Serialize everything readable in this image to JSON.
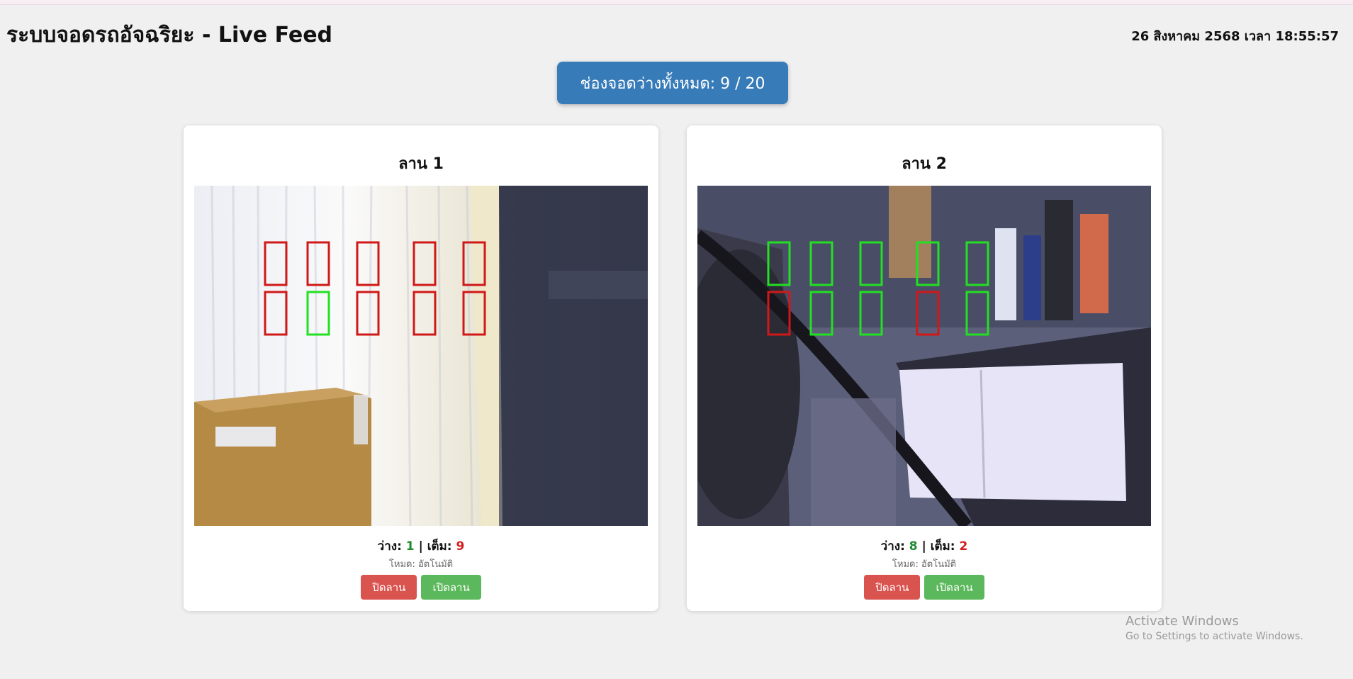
{
  "header": {
    "title": "ระบบจอดรถอัจฉริยะ - Live Feed",
    "datetime": "26 สิงหาคม 2568 เวลา 18:55:57"
  },
  "summary": {
    "label": "ช่องจอดว่างทั้งหมด: 9 / 20"
  },
  "lots": [
    {
      "title": "ลาน 1",
      "free_label": "ว่าง:",
      "free": "1",
      "full_label": "เต็ม:",
      "full": "9",
      "mode": "โหมด: อัตโนมัติ",
      "close_label": "ปิดลาน",
      "open_label": "เปิดลาน",
      "slot_status": [
        "occupied",
        "occupied",
        "occupied",
        "occupied",
        "occupied",
        "occupied",
        "free",
        "occupied",
        "occupied",
        "occupied"
      ]
    },
    {
      "title": "ลาน 2",
      "free_label": "ว่าง:",
      "free": "8",
      "full_label": "เต็ม:",
      "full": "2",
      "mode": "โหมด: อัตโนมัติ",
      "close_label": "ปิดลาน",
      "open_label": "เปิดลาน",
      "slot_status": [
        "free",
        "free",
        "free",
        "free",
        "free",
        "occupied",
        "free",
        "free",
        "occupied",
        "free"
      ]
    }
  ],
  "colors": {
    "free": "#22e022",
    "occupied": "#d01818",
    "badge": "#377bb8"
  },
  "watermark": {
    "line1": "Activate Windows",
    "line2": "Go to Settings to activate Windows."
  }
}
